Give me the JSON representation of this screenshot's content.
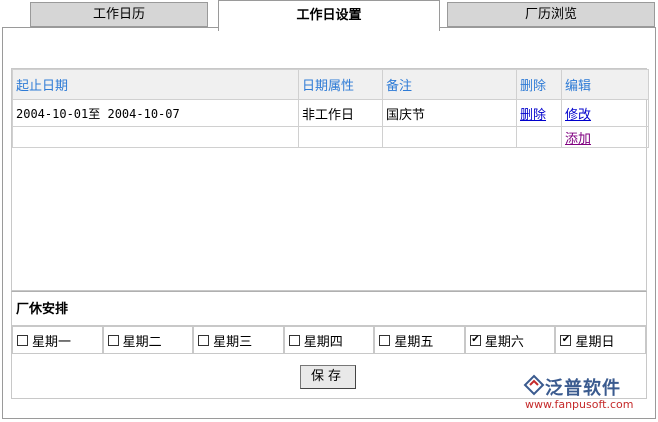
{
  "tabs": [
    {
      "label": "工作日历",
      "active": false
    },
    {
      "label": "工作日设置",
      "active": true
    },
    {
      "label": "厂历浏览",
      "active": false
    }
  ],
  "table": {
    "headers": [
      "起止日期",
      "日期属性",
      "备注",
      "删除",
      "编辑"
    ],
    "rows": [
      {
        "date_range": "2004-10-01至 2004-10-07",
        "attribute": "非工作日",
        "remark": "国庆节",
        "delete": "删除",
        "edit": "修改"
      }
    ],
    "add_label": "添加"
  },
  "rest": {
    "title": "厂休安排",
    "days": [
      {
        "label": "星期一",
        "checked": false
      },
      {
        "label": "星期二",
        "checked": false
      },
      {
        "label": "星期三",
        "checked": false
      },
      {
        "label": "星期四",
        "checked": false
      },
      {
        "label": "星期五",
        "checked": false
      },
      {
        "label": "星期六",
        "checked": true
      },
      {
        "label": "星期日",
        "checked": true
      }
    ]
  },
  "save_label": "保存",
  "watermark": {
    "name": "泛普软件",
    "url": "www.fanpusoft.com"
  },
  "colors": {
    "header_text": "#2e7bd6",
    "link": "#0000cc",
    "visited_link": "#800080"
  }
}
